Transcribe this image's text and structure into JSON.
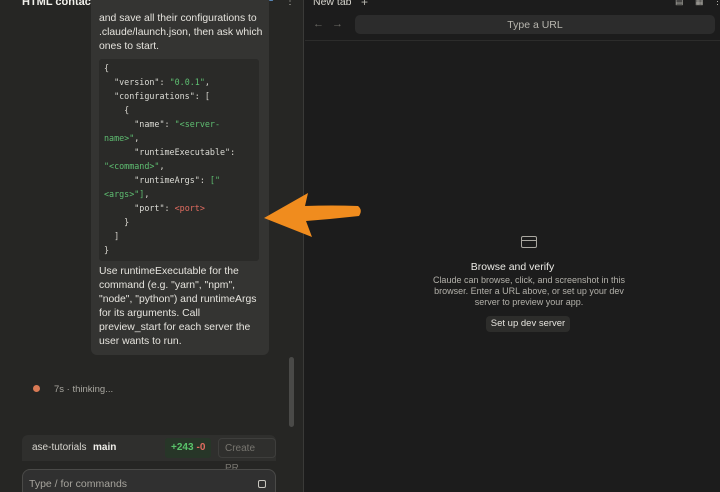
{
  "header": {
    "title": "HTML contact form page",
    "repo": "ase-tutorials",
    "icons": [
      "terminal-icon",
      "document-icon",
      "globe-icon",
      "more-icon"
    ]
  },
  "message": {
    "intro": "and save all their configurations to .claude/launch.json, then ask which ones to start.",
    "code": {
      "version_key": "\"version\"",
      "version_val": "\"0.0.1\"",
      "configurations_key": "\"configurations\"",
      "name_key": "\"name\"",
      "name_val_1": "\"<server-",
      "name_val_2": "name>\"",
      "runtimeExecutable_key": "\"runtimeExecutable\"",
      "runtimeExecutable_val": "\"<command>\"",
      "runtimeArgs_key": "\"runtimeArgs\"",
      "runtimeArgs_val_1": "[\"",
      "runtimeArgs_val_2": "<args>\"]",
      "port_key": "\"port\"",
      "port_val": "<port>"
    },
    "outro": "Use runtimeExecutable for the command (e.g. \"yarn\", \"npm\", \"node\", \"python\") and runtimeArgs for its arguments. Call preview_start for each server the user wants to run."
  },
  "status": {
    "text": "7s · thinking..."
  },
  "branch": {
    "repo": "ase-tutorials",
    "name": "main",
    "additions": "+243",
    "deletions": "-0",
    "create_pr": "Create PR"
  },
  "composer": {
    "placeholder": "Type / for commands",
    "value": ""
  },
  "browser": {
    "tab": "New tab",
    "url_placeholder": "Type a URL",
    "empty_title": "Browse and verify",
    "empty_desc": "Claude can browse, click, and screenshot in this browser. Enter a URL above, or set up your dev server to preview your app.",
    "setup_button": "Set up dev server"
  },
  "colors": {
    "accent_orange": "#f08c1e",
    "status_dot": "#d97a55",
    "json_string": "#5fbf72",
    "json_value_red": "#e06c60"
  }
}
